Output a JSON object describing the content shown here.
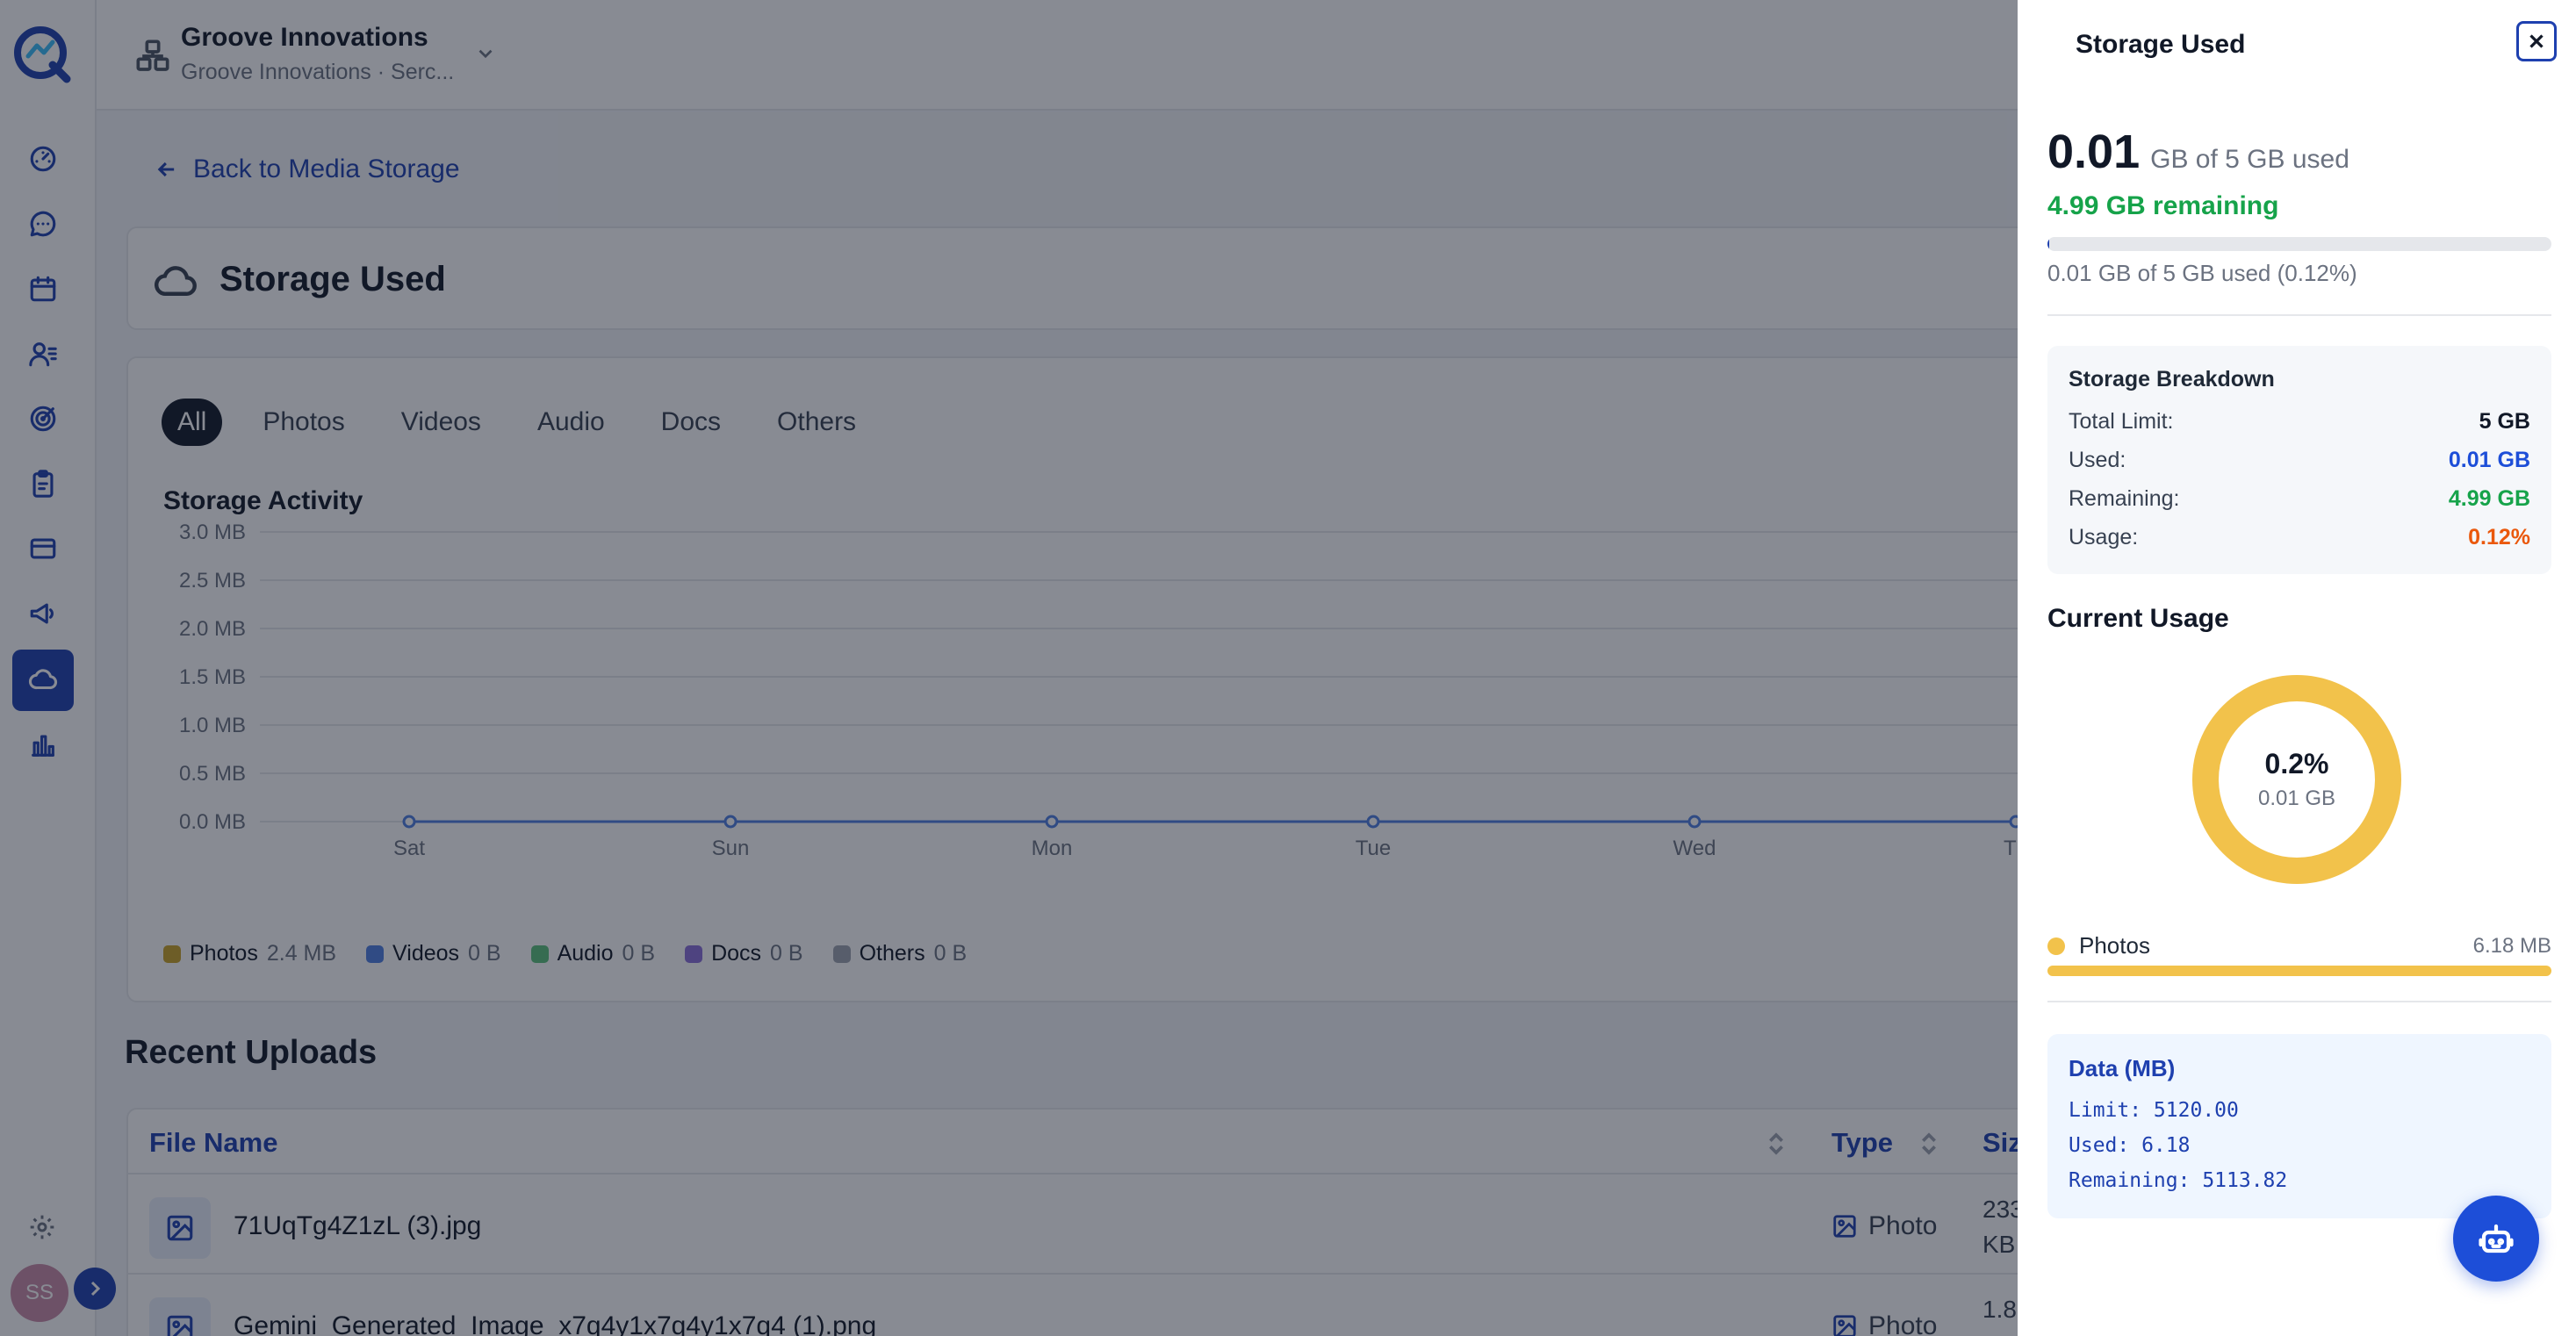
{
  "colors": {
    "accent": "#1e40af",
    "green": "#16a34a",
    "orange": "#ea580c",
    "photos": "#f2c24b",
    "videos": "#4f7fe0",
    "audio": "#5bc17a",
    "docs": "#8b6fd8",
    "others": "#9ca3af"
  },
  "sidebar": {
    "logo": "q-logo-icon",
    "items": [
      {
        "name": "dashboard",
        "icon": "gauge-icon"
      },
      {
        "name": "messages",
        "icon": "chat-icon"
      },
      {
        "name": "calendar",
        "icon": "calendar-icon"
      },
      {
        "name": "contacts",
        "icon": "user-list-icon"
      },
      {
        "name": "targets",
        "icon": "target-icon"
      },
      {
        "name": "tasks",
        "icon": "clipboard-icon"
      },
      {
        "name": "billing",
        "icon": "card-icon"
      },
      {
        "name": "campaigns",
        "icon": "megaphone-icon"
      },
      {
        "name": "storage",
        "icon": "cloud-icon",
        "active": true
      },
      {
        "name": "analytics",
        "icon": "bar-chart-icon"
      }
    ],
    "avatar_initials": "SS"
  },
  "header": {
    "org_name": "Groove Innovations",
    "org_sub": "Groove Innovations · Serc..."
  },
  "main": {
    "back_label": "Back to Media Storage",
    "page_title": "Storage Used",
    "tabs": [
      "All",
      "Photos",
      "Videos",
      "Audio",
      "Docs",
      "Others"
    ],
    "active_tab": "All",
    "activity_title": "Storage Activity",
    "legend": [
      {
        "label": "Photos",
        "value": "2.4 MB",
        "color": "#c9a227"
      },
      {
        "label": "Videos",
        "value": "0 B",
        "color": "#4f7fe0"
      },
      {
        "label": "Audio",
        "value": "0 B",
        "color": "#5bc17a"
      },
      {
        "label": "Docs",
        "value": "0 B",
        "color": "#8b6fd8"
      },
      {
        "label": "Others",
        "value": "0 B",
        "color": "#9ca3af"
      }
    ],
    "recent_title": "Recent Uploads",
    "table": {
      "headers": {
        "file_name": "File Name",
        "type": "Type",
        "size": "Siz"
      },
      "rows": [
        {
          "file_name": "71UqTg4Z1zL (3).jpg",
          "type": "Photo",
          "size_line1": "233",
          "size_line2": "KB"
        },
        {
          "file_name": "Gemini_Generated_Image_x7q4y1x7q4y1x7q4 (1).png",
          "type": "Photo",
          "size_line1": "1.8",
          "size_line2": ""
        }
      ]
    }
  },
  "chart_data": {
    "type": "line",
    "title": "Storage Activity",
    "categories": [
      "Sat",
      "Sun",
      "Mon",
      "Tue",
      "Wed",
      "Th"
    ],
    "series": [
      {
        "name": "Photos",
        "values": [
          0,
          0,
          0,
          0,
          0,
          0
        ]
      }
    ],
    "y_ticks": [
      "0.0 MB",
      "0.5 MB",
      "1.0 MB",
      "1.5 MB",
      "2.0 MB",
      "2.5 MB",
      "3.0 MB"
    ],
    "ylim": [
      0,
      3.0
    ],
    "grid": true,
    "legend_placement": "bottom-left"
  },
  "drawer": {
    "title": "Storage Used",
    "used_value": "0.01",
    "used_of": "GB of 5 GB used",
    "remaining": "4.99 GB remaining",
    "progress_fraction": 0.0012,
    "progress_text": "0.01 GB of 5 GB used (0.12%)",
    "breakdown": {
      "title": "Storage Breakdown",
      "rows": [
        {
          "label": "Total Limit:",
          "value": "5 GB",
          "color": "#111827"
        },
        {
          "label": "Used:",
          "value": "0.01 GB",
          "color": "#1d4ed8"
        },
        {
          "label": "Remaining:",
          "value": "4.99 GB",
          "color": "#16a34a"
        },
        {
          "label": "Usage:",
          "value": "0.12%",
          "color": "#ea580c"
        }
      ]
    },
    "current_title": "Current Usage",
    "donut": {
      "pct": "0.2%",
      "sub": "0.01 GB"
    },
    "photos": {
      "label": "Photos",
      "size": "6.18 MB",
      "fraction": 1.0
    },
    "data_box": {
      "title": "Data (MB)",
      "lines": [
        "Limit: 5120.00",
        "Used: 6.18",
        "Remaining: 5113.82"
      ]
    }
  }
}
